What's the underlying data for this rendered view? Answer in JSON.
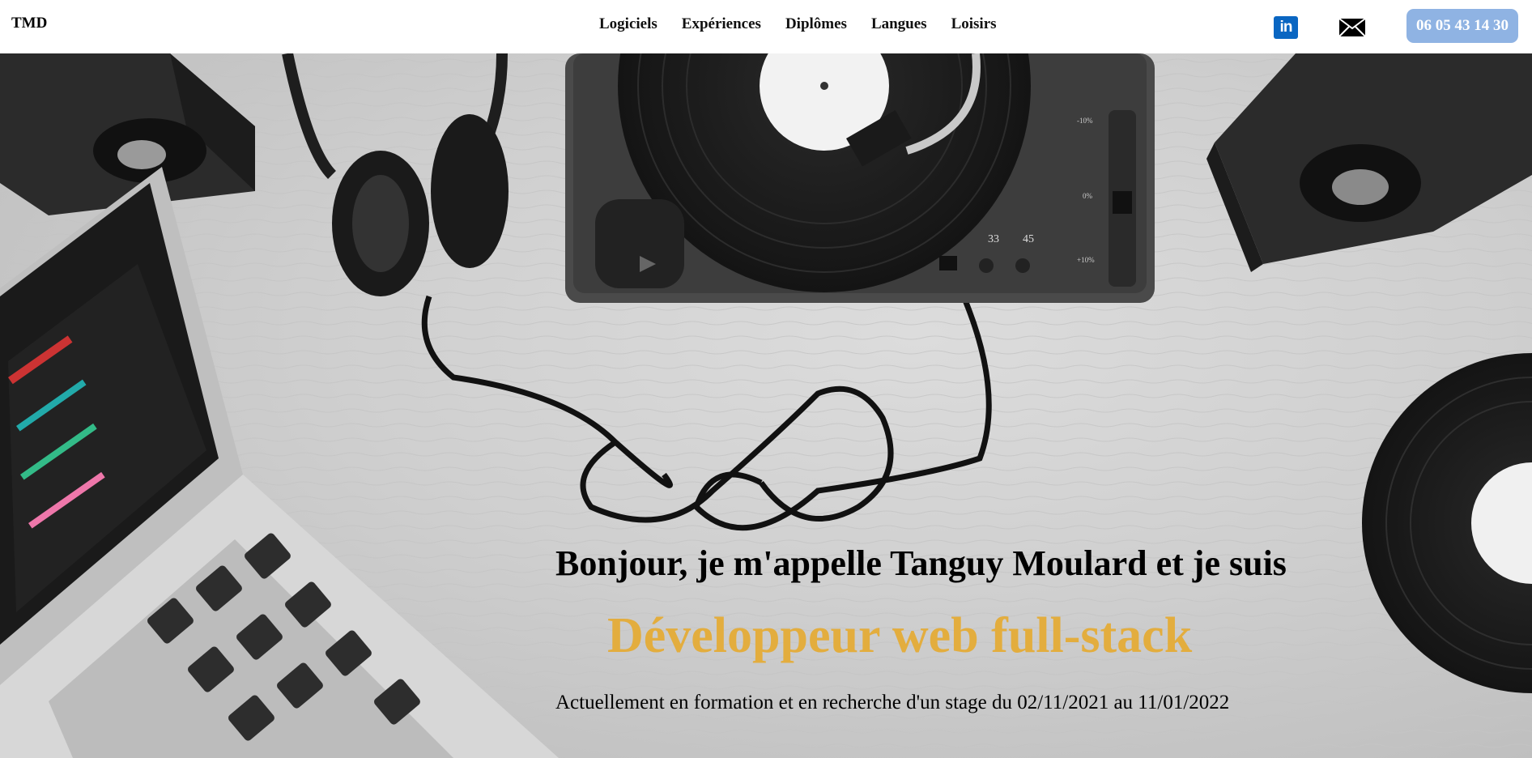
{
  "header": {
    "logo": "TMD",
    "nav": [
      {
        "label": "Logiciels"
      },
      {
        "label": "Expériences"
      },
      {
        "label": "Diplômes"
      },
      {
        "label": "Langues"
      },
      {
        "label": "Loisirs"
      }
    ],
    "linkedin_text": "in",
    "phone": "06 05 43 14 30"
  },
  "hero": {
    "greeting": "Bonjour, je m'appelle Tanguy Moulard et je suis",
    "role": "Développeur web full-stack",
    "status": "Actuellement en formation et en recherche d'un stage du 02/11/2021 au 11/01/2022",
    "turntable_speeds": [
      "33",
      "45"
    ],
    "pitch_marks": [
      "-10%",
      "0%",
      "+10%"
    ]
  },
  "icons": {
    "linkedin": "linkedin-icon",
    "mail": "mail-icon"
  },
  "colors": {
    "role_accent": "#e3ad3e",
    "phone_button": "#8fb3e3",
    "linkedin": "#0a66c2"
  }
}
